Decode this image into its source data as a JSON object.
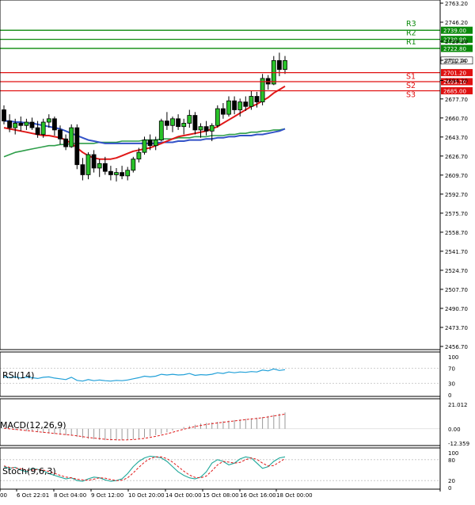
{
  "chart_data": {
    "type": "candlestick",
    "price_panel": {
      "ylim": [
        2456.7,
        2763.2
      ],
      "y_ticks": [
        "2763.20",
        "2746.20",
        "2729.20",
        "2712.20",
        "2694.20",
        "2677.70",
        "2660.70",
        "2643.70",
        "2626.70",
        "2609.70",
        "2592.70",
        "2575.70",
        "2558.70",
        "2541.70",
        "2524.70",
        "2507.70",
        "2490.70",
        "2473.70",
        "2456.70"
      ],
      "current_price": "2711.74",
      "levels": [
        {
          "name": "R3",
          "value": 2739.0,
          "label": "2739.00",
          "color": "#0b8a0b"
        },
        {
          "name": "R2",
          "value": 2730.9,
          "label": "2730.90",
          "color": "#0b8a0b"
        },
        {
          "name": "R1",
          "value": 2722.8,
          "label": "2722.80",
          "color": "#0b8a0b"
        },
        {
          "name": "S1",
          "value": 2701.2,
          "label": "2701.20",
          "color": "#e01010"
        },
        {
          "name": "S2",
          "value": 2693.1,
          "label": "2693.10",
          "color": "#e01010"
        },
        {
          "name": "S3",
          "value": 2685.0,
          "label": "2685.00",
          "color": "#e01010"
        }
      ],
      "candles": [
        [
          2668,
          2672,
          2655,
          2658
        ],
        [
          2658,
          2664,
          2648,
          2652
        ],
        [
          2652,
          2660,
          2646,
          2656
        ],
        [
          2656,
          2662,
          2649,
          2654
        ],
        [
          2654,
          2660,
          2650,
          2657
        ],
        [
          2657,
          2661,
          2650,
          2652
        ],
        [
          2652,
          2658,
          2643,
          2646
        ],
        [
          2646,
          2660,
          2643,
          2657
        ],
        [
          2657,
          2664,
          2652,
          2660
        ],
        [
          2660,
          2662,
          2645,
          2650
        ],
        [
          2650,
          2654,
          2637,
          2642
        ],
        [
          2642,
          2646,
          2632,
          2635
        ],
        [
          2635,
          2655,
          2634,
          2652
        ],
        [
          2652,
          2655,
          2615,
          2619
        ],
        [
          2619,
          2625,
          2605,
          2610
        ],
        [
          2610,
          2630,
          2606,
          2628
        ],
        [
          2628,
          2632,
          2612,
          2616
        ],
        [
          2616,
          2624,
          2608,
          2620
        ],
        [
          2620,
          2626,
          2610,
          2613
        ],
        [
          2613,
          2618,
          2605,
          2610
        ],
        [
          2610,
          2616,
          2604,
          2612
        ],
        [
          2612,
          2618,
          2606,
          2609
        ],
        [
          2609,
          2617,
          2605,
          2614
        ],
        [
          2614,
          2626,
          2612,
          2624
        ],
        [
          2624,
          2634,
          2621,
          2630
        ],
        [
          2630,
          2644,
          2628,
          2641
        ],
        [
          2641,
          2646,
          2632,
          2636
        ],
        [
          2636,
          2644,
          2632,
          2641
        ],
        [
          2641,
          2660,
          2640,
          2658
        ],
        [
          2658,
          2666,
          2650,
          2654
        ],
        [
          2654,
          2662,
          2648,
          2660
        ],
        [
          2660,
          2664,
          2650,
          2653
        ],
        [
          2653,
          2660,
          2646,
          2656
        ],
        [
          2656,
          2668,
          2652,
          2663
        ],
        [
          2663,
          2666,
          2646,
          2650
        ],
        [
          2650,
          2656,
          2643,
          2653
        ],
        [
          2653,
          2658,
          2645,
          2649
        ],
        [
          2649,
          2656,
          2640,
          2654
        ],
        [
          2654,
          2672,
          2652,
          2669
        ],
        [
          2669,
          2674,
          2660,
          2664
        ],
        [
          2664,
          2680,
          2662,
          2676
        ],
        [
          2676,
          2680,
          2664,
          2668
        ],
        [
          2668,
          2678,
          2662,
          2675
        ],
        [
          2675,
          2680,
          2667,
          2671
        ],
        [
          2671,
          2685,
          2668,
          2680
        ],
        [
          2680,
          2684,
          2670,
          2675
        ],
        [
          2675,
          2700,
          2672,
          2696
        ],
        [
          2696,
          2699,
          2686,
          2691
        ],
        [
          2691,
          2716,
          2690,
          2712
        ],
        [
          2712,
          2719,
          2698,
          2704
        ],
        [
          2704,
          2716,
          2700,
          2712
        ]
      ],
      "ma_red": [
        2652,
        2651,
        2650,
        2649,
        2648,
        2647,
        2646,
        2645,
        2645,
        2644,
        2643,
        2641,
        2638,
        2634,
        2630,
        2627,
        2625,
        2624,
        2624,
        2624,
        2625,
        2627,
        2629,
        2631,
        2632,
        2633,
        2634,
        2636,
        2638,
        2640,
        2642,
        2644,
        2645,
        2646,
        2647,
        2648,
        2649,
        2651,
        2653,
        2656,
        2659,
        2662,
        2665,
        2668,
        2671,
        2673,
        2676,
        2679,
        2683,
        2686,
        2689
      ],
      "ma_blue": [
        2658,
        2658,
        2657,
        2657,
        2656,
        2656,
        2655,
        2654,
        2653,
        2652,
        2651,
        2649,
        2647,
        2645,
        2643,
        2641,
        2640,
        2639,
        2638,
        2638,
        2638,
        2638,
        2638,
        2638,
        2638,
        2638,
        2638,
        2638,
        2639,
        2639,
        2639,
        2640,
        2640,
        2641,
        2641,
        2641,
        2642,
        2642,
        2643,
        2643,
        2644,
        2644,
        2645,
        2645,
        2645,
        2646,
        2646,
        2647,
        2648,
        2649,
        2651
      ],
      "ma_green": [
        2626,
        2628,
        2630,
        2631,
        2632,
        2633,
        2634,
        2635,
        2636,
        2636,
        2637,
        2637,
        2638,
        2638,
        2638,
        2638,
        2638,
        2639,
        2639,
        2639,
        2639,
        2640,
        2640,
        2640,
        2640,
        2641,
        2641,
        2641,
        2642,
        2642,
        2642,
        2643,
        2643,
        2643,
        2644,
        2644,
        2644,
        2645,
        2645,
        2645,
        2646,
        2646,
        2647,
        2647,
        2648,
        2648,
        2649,
        2649,
        2650,
        2650,
        2651
      ]
    },
    "x_ticks": [
      "00",
      "6 Oct 22:01",
      "8 Oct 04:00",
      "9 Oct 12:00",
      "10 Oct 20:00",
      "14 Oct 00:00",
      "15 Oct 08:00",
      "16 Oct 16:00",
      "18 Oct 00:00"
    ],
    "rsi_panel": {
      "label": "RSI(14)",
      "ylim": [
        0,
        100
      ],
      "y_ticks": [
        "100",
        "70",
        "30",
        "0"
      ],
      "values": [
        48,
        45,
        47,
        44,
        46,
        45,
        43,
        46,
        47,
        44,
        42,
        40,
        46,
        38,
        36,
        40,
        37,
        39,
        37,
        36,
        38,
        37,
        39,
        42,
        45,
        49,
        47,
        49,
        54,
        52,
        54,
        52,
        53,
        56,
        51,
        53,
        52,
        54,
        58,
        56,
        60,
        58,
        60,
        59,
        61,
        60,
        65,
        63,
        68,
        64,
        66
      ]
    },
    "macd_panel": {
      "label": "MACD(12,26,9)",
      "ylim": [
        -12.359,
        21.012
      ],
      "y_ticks": [
        "21.012",
        "0.00",
        "-12.359"
      ],
      "histogram": [
        0,
        -0.5,
        -1,
        -1.5,
        -2,
        -2.5,
        -3,
        -3.5,
        -4,
        -4.5,
        -5,
        -5.5,
        -6,
        -7,
        -8,
        -8.5,
        -9,
        -9.5,
        -9.8,
        -10,
        -10,
        -9.8,
        -9.5,
        -9,
        -8.5,
        -7.5,
        -6.5,
        -5.5,
        -4.5,
        -3,
        -1.5,
        0,
        1.5,
        2.5,
        3.5,
        4.5,
        5,
        5.5,
        6,
        6.5,
        7,
        7.5,
        8,
        8.5,
        9,
        9.5,
        10,
        11,
        12,
        13,
        14
      ],
      "signal": [
        0.5,
        0,
        -0.5,
        -1,
        -1.5,
        -2,
        -2.5,
        -3,
        -3.5,
        -4,
        -4.5,
        -5,
        -5.5,
        -6,
        -6.8,
        -7.5,
        -8,
        -8.5,
        -9,
        -9.3,
        -9.5,
        -9.6,
        -9.5,
        -9.2,
        -8.8,
        -8.2,
        -7.4,
        -6.5,
        -5.5,
        -4.3,
        -3,
        -1.7,
        -0.4,
        0.8,
        1.9,
        2.9,
        3.7,
        4.4,
        5,
        5.6,
        6.2,
        6.7,
        7.3,
        7.9,
        8.4,
        8.9,
        9.5,
        10.2,
        11,
        11.8,
        12.6
      ]
    },
    "stoch_panel": {
      "label": "Stoch(9,6,3)",
      "ylim": [
        0,
        100
      ],
      "y_ticks": [
        "100",
        "80",
        "20",
        "0"
      ],
      "k": [
        60,
        55,
        58,
        50,
        45,
        55,
        52,
        48,
        40,
        35,
        30,
        25,
        28,
        20,
        18,
        25,
        30,
        28,
        22,
        18,
        20,
        25,
        40,
        60,
        75,
        85,
        90,
        88,
        85,
        75,
        60,
        45,
        35,
        28,
        25,
        30,
        45,
        70,
        80,
        75,
        65,
        70,
        82,
        88,
        85,
        70,
        55,
        60,
        75,
        85,
        88
      ],
      "d": [
        62,
        58,
        56,
        54,
        50,
        50,
        52,
        50,
        46,
        41,
        35,
        30,
        28,
        24,
        22,
        21,
        24,
        28,
        27,
        23,
        20,
        21,
        28,
        42,
        58,
        73,
        83,
        88,
        88,
        83,
        73,
        60,
        47,
        36,
        29,
        28,
        33,
        48,
        65,
        75,
        73,
        70,
        72,
        80,
        85,
        81,
        70,
        62,
        63,
        73,
        83
      ]
    }
  }
}
